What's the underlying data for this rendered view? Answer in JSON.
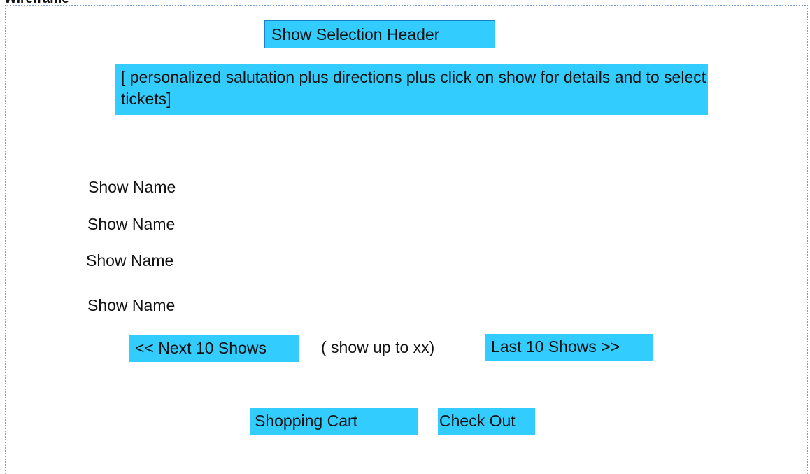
{
  "wireframe_label": "Wireframe",
  "header": {
    "title": "Show Selection Header"
  },
  "intro": {
    "text": "[ personalized salutation plus directions plus click on show for details  and to select tickets]"
  },
  "shows": [
    {
      "name": "Show Name"
    },
    {
      "name": "Show Name"
    },
    {
      "name": "Show Name"
    },
    {
      "name": "Show Name"
    }
  ],
  "pagination": {
    "next_label": "<< Next 10 Shows",
    "note": "( show up to xx)",
    "last_label": "Last 10 Shows >>"
  },
  "actions": {
    "cart_label": "Shopping Cart",
    "checkout_label": "Check Out"
  },
  "colors": {
    "box_fill": "#33ccff",
    "frame_border": "#7a9ed0",
    "header_border": "#1f7fc4"
  }
}
